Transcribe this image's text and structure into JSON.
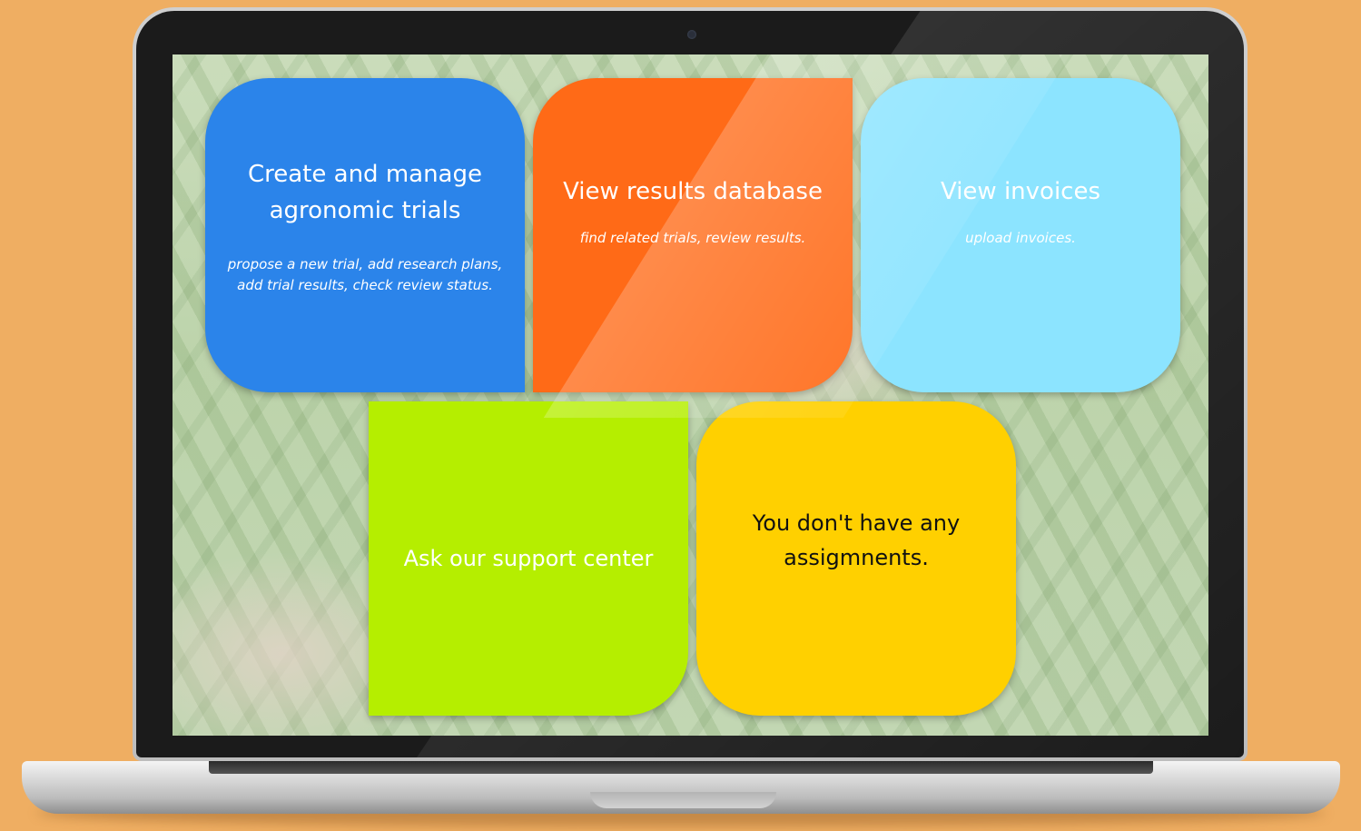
{
  "theme": {
    "background": "#EFAE62",
    "tile_colors": {
      "trials": "#2B84EA",
      "results": "#FF6A17",
      "invoices": "#8CE4FF",
      "support": "#B5EE00",
      "assignments": "#FFD000"
    }
  },
  "tiles": {
    "trials": {
      "title_line1": "Create and manage",
      "title_line2": "agronomic trials",
      "sub_line1": "propose a new trial, add research plans,",
      "sub_line2": "add trial results, check review status."
    },
    "results": {
      "title": "View results database",
      "sub": "find related trials, review results."
    },
    "invoices": {
      "title": "View invoices",
      "sub": "upload invoices."
    },
    "support": {
      "title": "Ask our support center"
    },
    "assignments": {
      "title_line1": "You don't have any",
      "title_line2": "assigmnents."
    }
  }
}
